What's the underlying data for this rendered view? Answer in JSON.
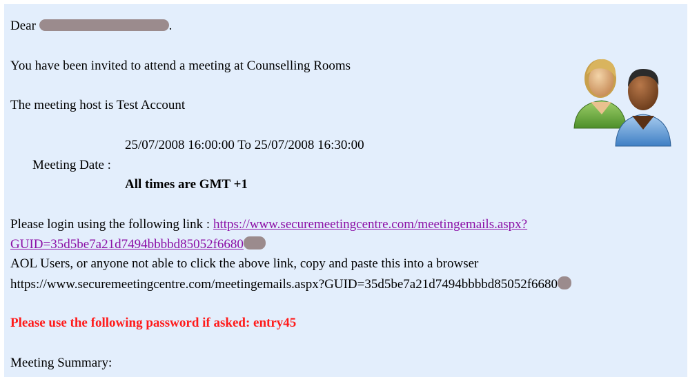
{
  "email": {
    "greeting": "Dear",
    "greeting_end": ".",
    "invite_line": "You have been invited to attend a meeting at Counselling Rooms",
    "host_line": "The meeting host is Test Account",
    "meeting_date_label": "Meeting Date :",
    "meeting_date_value": "25/07/2008 16:00:00 To 25/07/2008 16:30:00",
    "timezone_note": "All times are GMT +1",
    "login_prompt": "Please login using the following link :",
    "login_link_line1": "https://www.securemeetingcentre.com/meetingemails.aspx?",
    "login_link_line2": "GUID=35d5be7a21d7494bbbbd85052f6680",
    "aol_note": "AOL Users, or anyone not able to click the above link, copy and paste this into a browser",
    "plain_url": "https://www.securemeetingcentre.com/meetingemails.aspx?GUID=35d5be7a21d7494bbbbd85052f6680",
    "password_line": "Please use the following password if asked: entry45",
    "summary_label": "Meeting Summary:"
  },
  "icons": {
    "attendees": "people-icon"
  },
  "colors": {
    "background": "#e3eefc",
    "link": "#8b0fa6",
    "warning": "#ff1a1a",
    "redaction": "#9b8b8d"
  }
}
